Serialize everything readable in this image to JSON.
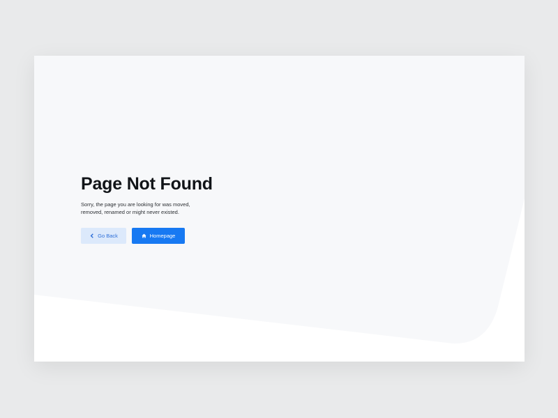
{
  "page": {
    "title": "Page Not Found",
    "description": "Sorry, the page you are looking for was moved, removed, renamed or might never existed."
  },
  "actions": {
    "back_label": "Go Back",
    "back_icon": "chevron-left-icon",
    "home_label": "Homepage",
    "home_icon": "home-icon"
  },
  "colors": {
    "page_background": "#e9eaeb",
    "card_background": "#ffffff",
    "shape_fill": "#f7f8fa",
    "title": "#111418",
    "primary": "#1779f2",
    "secondary_bg": "#dce9fb",
    "secondary_text": "#2e6fd8"
  }
}
